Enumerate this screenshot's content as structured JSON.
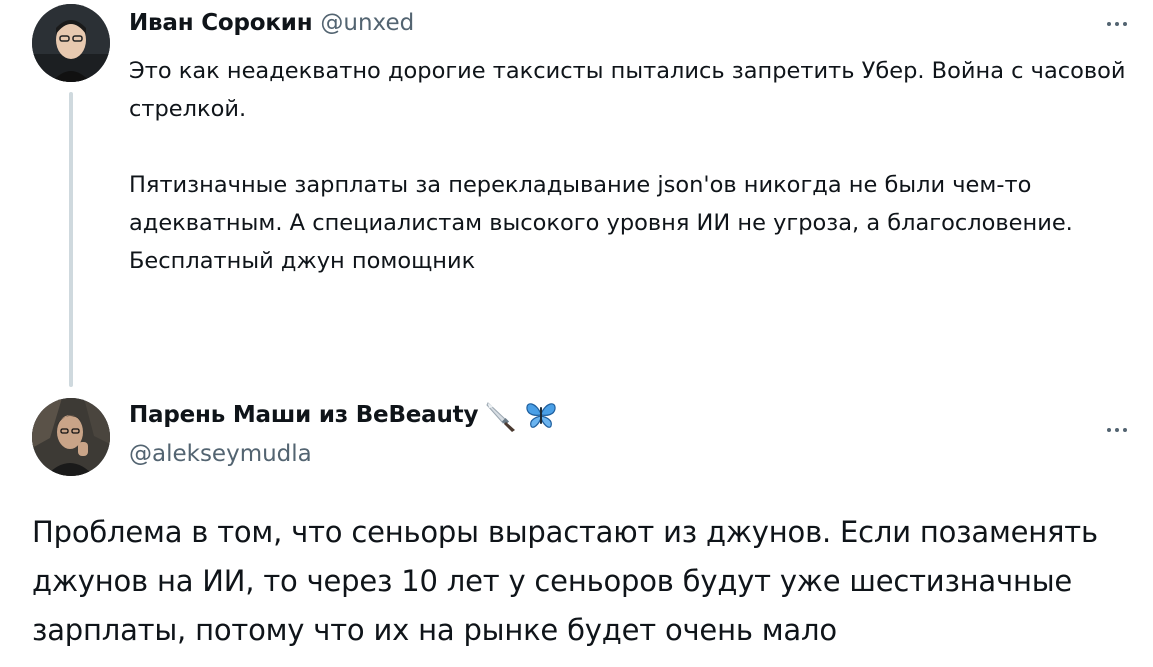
{
  "thread": {
    "parent": {
      "author": {
        "display_name": "Иван Сорокин",
        "handle": "@unxed"
      },
      "more_label": "More",
      "paragraphs": [
        "Это как неадекватно дорогие таксисты пытались запретить Убер. Война с часовой стрелкой.",
        "Пятизначные зарплаты за перекладывание json'ов никогда не были чем-то адекватным. А специалистам высокого уровня ИИ не угроза, а благословение. Бесплатный джун помощник"
      ]
    },
    "reply": {
      "author": {
        "display_name": "Парень Маши из BeBeauty",
        "handle": "@alekseymudla",
        "emojis": [
          "knife-emoji",
          "butterfly-emoji"
        ]
      },
      "more_label": "More",
      "text": "Проблема в том, что сеньоры вырастают из джунов. Если позаменять джунов на ИИ, то через 10 лет у сеньоров будут уже шестизначные зарплаты, потому что их на рынке будет очень мало"
    }
  },
  "colors": {
    "text_primary": "#0f1419",
    "text_secondary": "#536471",
    "thread_line": "#cfd9de",
    "butterfly": "#4a9fe6"
  }
}
